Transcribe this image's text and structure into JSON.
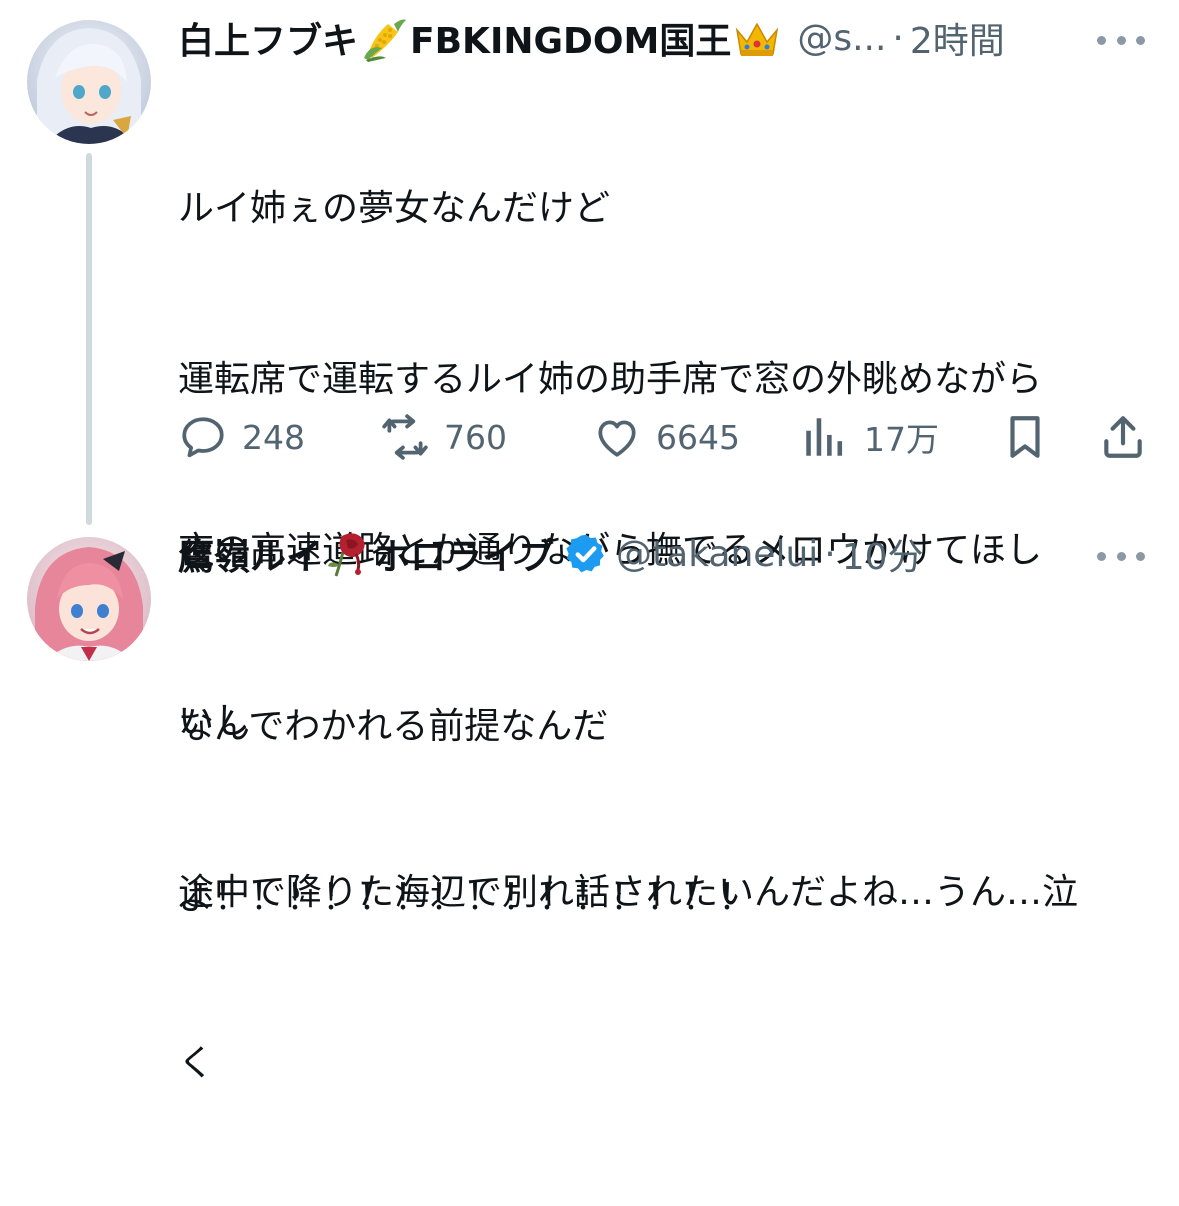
{
  "tweet1": {
    "name": "白上フブキ",
    "name_suffix": "FBKINGDOM国王",
    "handle": "@s...",
    "separator": "·",
    "time": "2時間",
    "lines": [
      "ルイ姉ぇの夢女なんだけど",
      "運転席で運転するルイ姉の助手席で窓の外眺めながら",
      "夜の高速道路とか通りながら撫でるメロウかけてほし",
      "いし",
      "途中で降りた海辺で別れ話されたいんだよね…うん…泣",
      "く"
    ],
    "actions": {
      "replies": "248",
      "retweets": "760",
      "likes": "6645",
      "views": "17万"
    },
    "icons": [
      "corn-emoji",
      "crown-emoji",
      "reply-icon",
      "retweet-icon",
      "like-icon",
      "views-icon",
      "bookmark-icon",
      "share-icon",
      "more-icon"
    ]
  },
  "tweet2": {
    "name": "鷹嶺ルイ",
    "name_suffix": "ホロライブ",
    "handle": "@takanelui",
    "separator": "·",
    "time": "10分",
    "lines": [
      "なんでわかれる前提なんだ",
      "よ！！！！！！！！！！！！！！！"
    ],
    "icons": [
      "wilted-rose-emoji",
      "verified-badge-icon",
      "more-icon"
    ]
  },
  "colors": {
    "text": "#0f1419",
    "secondary": "#536471",
    "thread_line": "#cfd9de",
    "verified": "#1d9bf0"
  }
}
